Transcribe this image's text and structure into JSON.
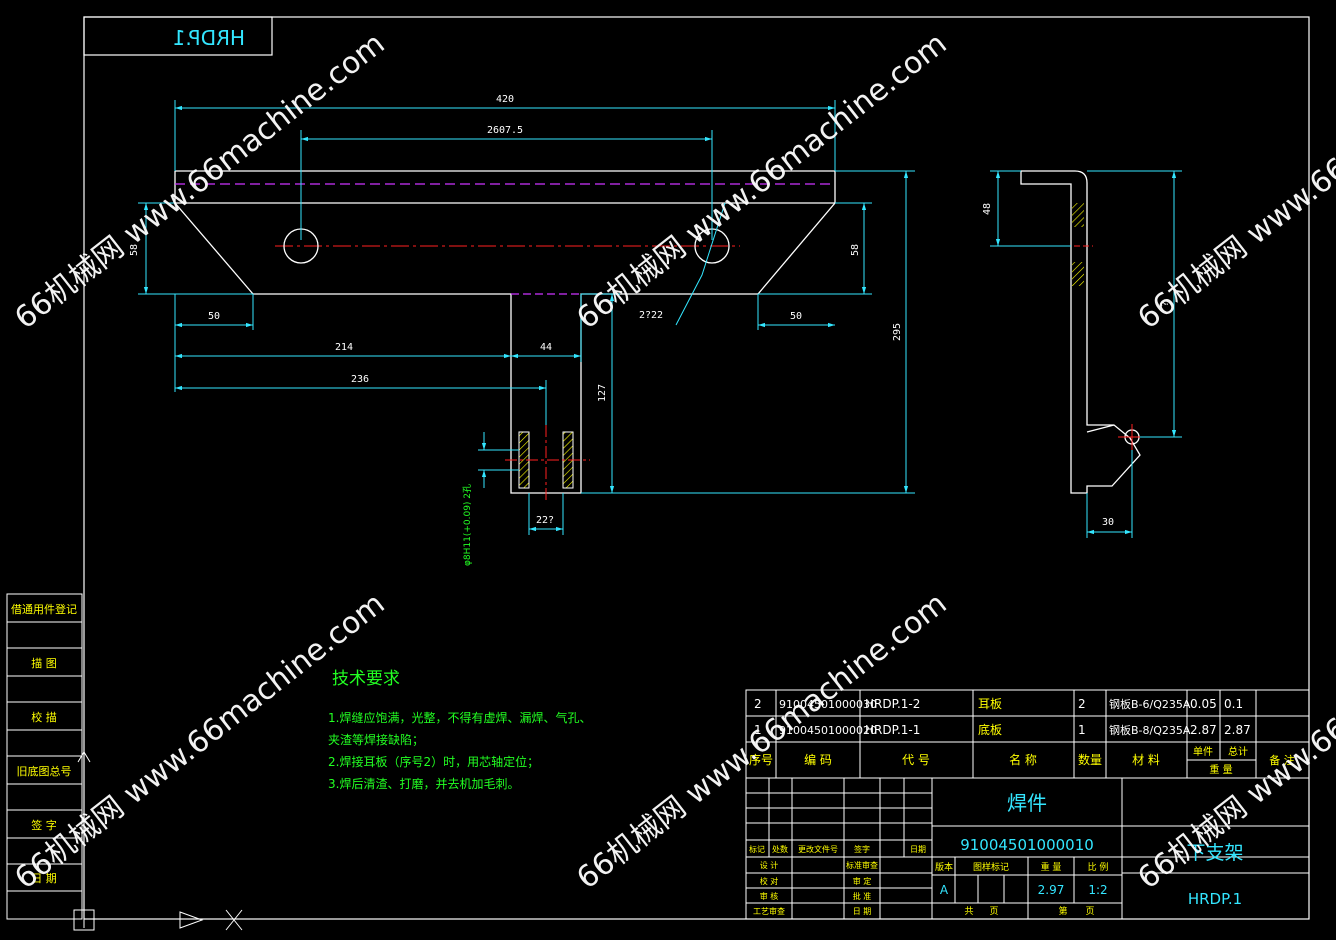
{
  "drawing": {
    "code_stamp": "HRDP.1",
    "dimensions": {
      "d420": "420",
      "d2607": "2607.5",
      "d58": "58",
      "d58r": "58",
      "d50l": "50",
      "d50r": "50",
      "d214": "214",
      "d44": "44",
      "d236": "236",
      "d127": "127",
      "d295": "295",
      "d2722": "2?22",
      "d227": "22?",
      "d48": "48",
      "d30": "30",
      "hole_note": "φ8H11(+0.09) 2孔",
      "side_height": "?"
    },
    "tech": {
      "title": "技术要求",
      "lines": [
        "1.焊缝应饱满，光整，不得有虚焊、漏焊、气孔、",
        "  夹渣等焊接缺陷；",
        "2.焊接耳板（序号2）时，用芯轴定位；",
        "3.焊后清渣、打磨，并去机加毛刺。"
      ]
    },
    "side_table": [
      "借通用件登记",
      "描 图",
      "校 描",
      "旧底图总号",
      "签 字",
      "日 期"
    ],
    "bom": {
      "rows": [
        {
          "no": "2",
          "code": "91004501000030",
          "ref": "HRDP.1-2",
          "name": "耳板",
          "qty": "2",
          "material": "钢板B-6/Q235A",
          "unit": "0.05",
          "total": "0.1"
        },
        {
          "no": "1",
          "code": "91004501000020",
          "ref": "HRDP.1-1",
          "name": "底板",
          "qty": "1",
          "material": "钢板B-8/Q235A",
          "unit": "2.87",
          "total": "2.87"
        }
      ],
      "header": {
        "no": "序号",
        "code": "编 码",
        "ref": "代 号",
        "name": "名 称",
        "qty": "数量",
        "material": "材 料",
        "unit": "单件",
        "total": "总计",
        "weight": "重 量",
        "remark": "备 注"
      }
    },
    "title_block": {
      "type_label": "焊件",
      "part_code": "91004501000010",
      "part_name": "下支架",
      "drawing_no": "HRDP.1",
      "revision": "A",
      "weight": "2.97",
      "scale": "1:2",
      "rev_headers": [
        "标记",
        "处数",
        "更改文件号",
        "签字",
        "日期"
      ],
      "signers": [
        "设 计",
        "校 对",
        "审 核",
        "工艺审查"
      ],
      "approvals": [
        "标准审查",
        "审 定",
        "批 准",
        "日 期"
      ],
      "info_headers": [
        "版本",
        "图样标记",
        "重 量",
        "比 例"
      ],
      "sheet": [
        "共",
        "页",
        "第",
        "页"
      ]
    },
    "watermark": "66机械网 www.66machine.com"
  }
}
